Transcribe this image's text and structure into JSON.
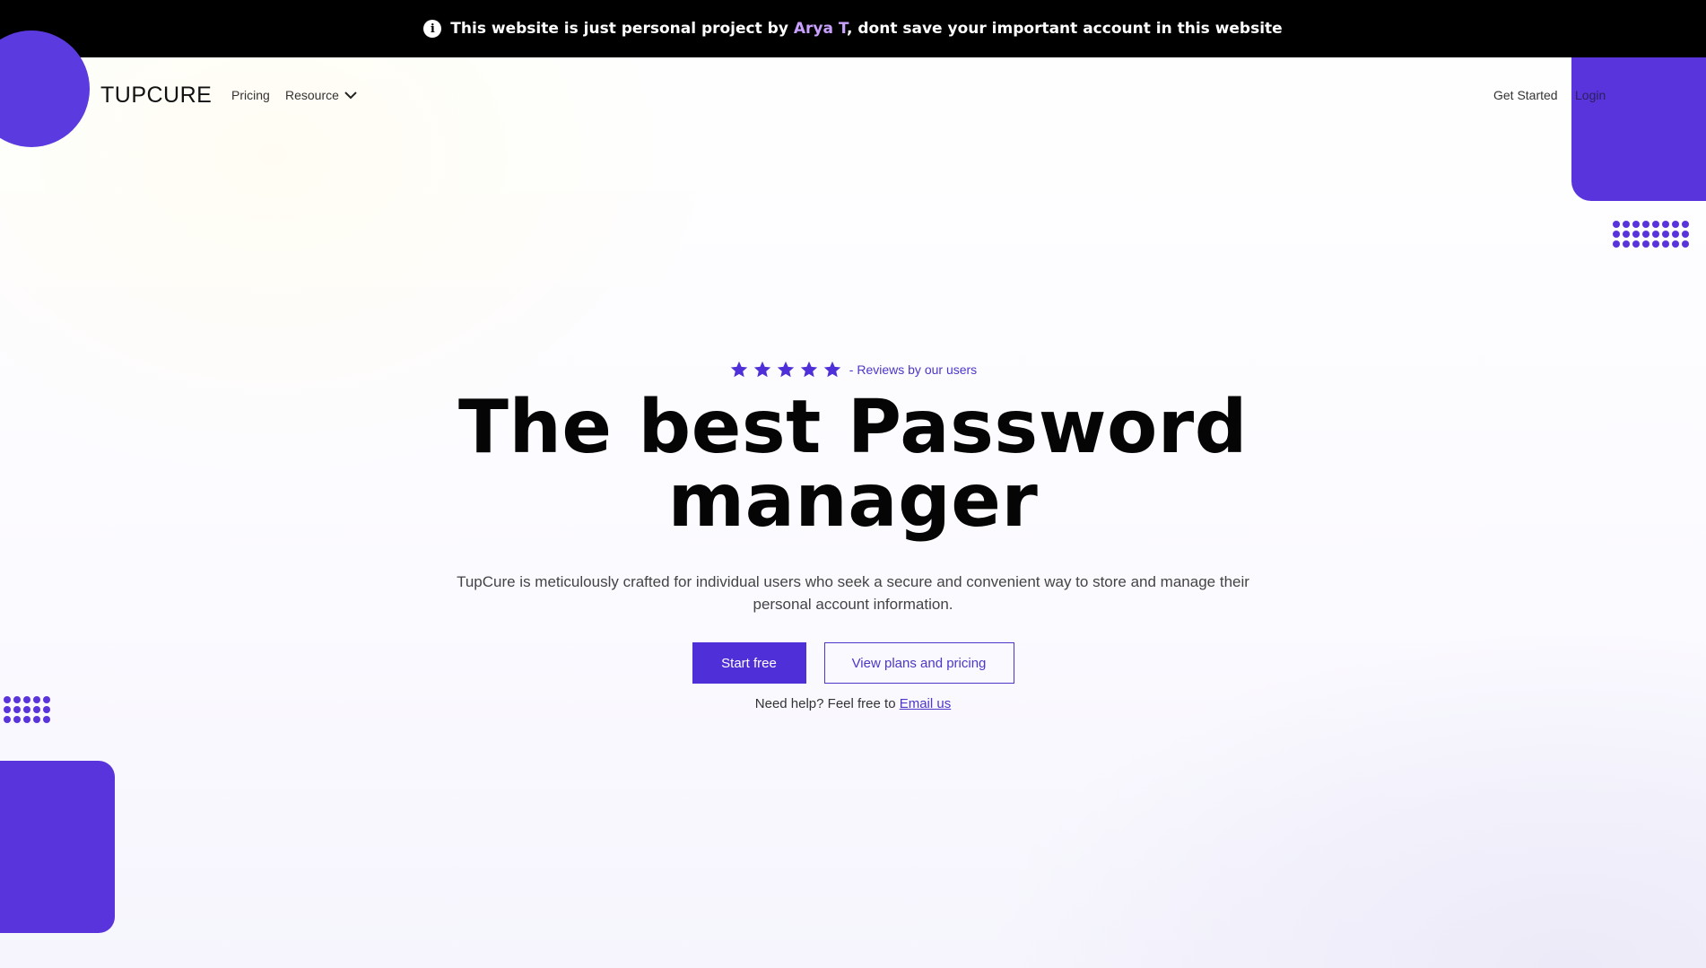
{
  "banner": {
    "icon": "info-icon",
    "prefix": "This website is just personal project by ",
    "author": "Arya T",
    "suffix": ", dont save your important account in this website"
  },
  "nav": {
    "logo": "TUPCURE",
    "pricing": "Pricing",
    "resource": "Resource",
    "get_started": "Get Started",
    "login": "Login"
  },
  "hero": {
    "rating": {
      "stars": 5,
      "text": "- Reviews by our users"
    },
    "headline_line1": "The best Password",
    "headline_line2": "manager",
    "subtitle": "TupCure is meticulously crafted for individual users who seek a secure and convenient way to store and manage their personal account information.",
    "primary_button": "Start free",
    "secondary_button": "View plans and pricing",
    "help_text": "Need help? Feel free to ",
    "help_link": "Email us"
  },
  "colors": {
    "brand": "#5934dc",
    "accent_text": "#4b37c9",
    "banner_bg": "#000000",
    "author_highlight": "#c9a0ff"
  }
}
